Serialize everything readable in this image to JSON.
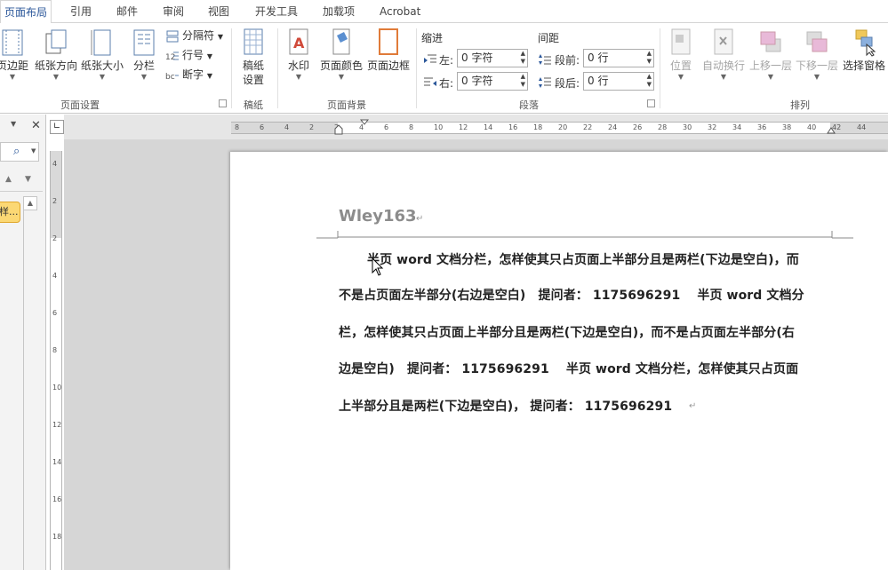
{
  "tabs": [
    "页面布局",
    "引用",
    "邮件",
    "审阅",
    "视图",
    "开发工具",
    "加载项",
    "Acrobat"
  ],
  "ribbon": {
    "page_setup": {
      "margins": "页边距",
      "orientation": "纸张方向",
      "size": "纸张大小",
      "columns": "分栏",
      "breaks": "分隔符",
      "line_numbers": "行号",
      "hyphenation": "断字",
      "group_label": "页面设置"
    },
    "manuscript": {
      "button": "稿纸\n设置",
      "line1": "稿纸",
      "line2": "设置",
      "group_label": "稿纸"
    },
    "page_background": {
      "watermark": "水印",
      "page_color": "页面颜色",
      "page_borders": "页面边框",
      "group_label": "页面背景"
    },
    "paragraph": {
      "indent_header": "缩进",
      "spacing_header": "间距",
      "left_label": "左:",
      "right_label": "右:",
      "before_label": "段前:",
      "after_label": "段后:",
      "left_value": "0 字符",
      "right_value": "0 字符",
      "before_value": "0 行",
      "after_value": "0 行",
      "group_label": "段落"
    },
    "arrange": {
      "position": "位置",
      "wrap_text": "自动换行",
      "bring_forward": "上移一层",
      "send_backward": "下移一层",
      "selection_pane": "选择窗格",
      "group_label": "排列"
    }
  },
  "navpane": {
    "close": "✕",
    "item_text": "样..."
  },
  "ruler": {
    "h_ticks": [
      "8",
      "6",
      "4",
      "2",
      "2",
      "4",
      "6",
      "8",
      "10",
      "12",
      "14",
      "16",
      "18",
      "20",
      "22",
      "24",
      "26",
      "28",
      "30",
      "32",
      "34",
      "36",
      "38",
      "40",
      "42",
      "44"
    ],
    "v_ticks": [
      "4",
      "2",
      "2",
      "4",
      "6",
      "8",
      "10",
      "12",
      "14",
      "16",
      "18"
    ]
  },
  "document": {
    "header": "Wley163",
    "lines": [
      "半页 word 文档分栏，怎样使其只占页面上半部分且是两栏(下边是空白)，而",
      "不是占页面左半部分(右边是空白)　提问者：  1175696291　 半页 word 文档分",
      "栏，怎样使其只占页面上半部分且是两栏(下边是空白)，而不是占页面左半部分(右",
      "边是空白)　提问者：  1175696291　 半页 word 文档分栏，怎样使其只占页面",
      "上半部分且是两栏(下边是空白)，  提问者：  1175696291"
    ],
    "paragraph_mark": "↵"
  }
}
